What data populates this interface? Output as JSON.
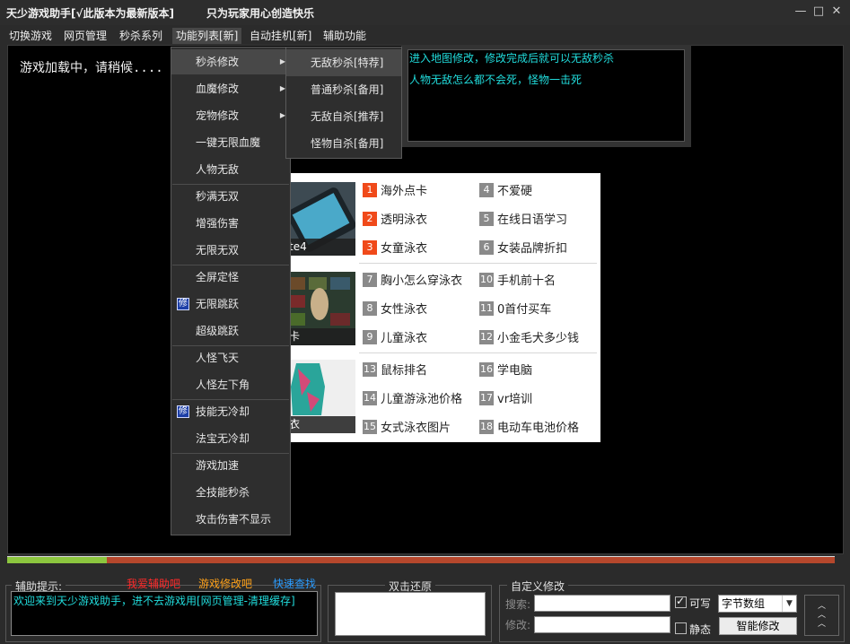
{
  "titlebar": {
    "title": "天少游戏助手[√此版本为最新版本]",
    "slogan": "只为玩家用心创造快乐",
    "buttons": [
      "—",
      "□",
      "✕"
    ]
  },
  "menubar": [
    "切换游戏",
    "网页管理",
    "秒杀系列",
    "功能列表[新]",
    "自动挂机[新]",
    "辅助功能"
  ],
  "main": {
    "loading_text": "游戏加载中，请稍候...."
  },
  "info": {
    "lines": [
      "进入地图修改，修改完成后就可以无敌秒杀",
      "人物无敌怎么都不会死，怪物一击死"
    ]
  },
  "dropdown": {
    "items": [
      "秒杀修改",
      "血魔修改",
      "宠物修改",
      "一键无限血魔",
      "人物无敌",
      "秒满无双",
      "增强伤害",
      "无限无双",
      "全屏定怪",
      "无限跳跃",
      "超级跳跃",
      "人怪飞天",
      "人怪左下角",
      "技能无冷却",
      "法宝无冷却",
      "游戏加速",
      "全技能秒杀",
      "攻击伤害不显示"
    ],
    "check_glyph": "修"
  },
  "submenu": {
    "items": [
      "无敌秒杀[特荐]",
      "普通秒杀[备用]",
      "无敌自杀[推荐]",
      "怪物自杀[备用]"
    ]
  },
  "ads": {
    "captions": [
      "te4",
      "卡",
      "衣"
    ],
    "links": [
      {
        "num": "1",
        "text": "海外点卡"
      },
      {
        "num": "4",
        "text": "不爱硬"
      },
      {
        "num": "2",
        "text": "透明泳衣"
      },
      {
        "num": "5",
        "text": "在线日语学习"
      },
      {
        "num": "3",
        "text": "女童泳衣"
      },
      {
        "num": "6",
        "text": "女装品牌折扣"
      },
      {
        "num": "7",
        "text": "胸小怎么穿泳衣"
      },
      {
        "num": "10",
        "text": "手机前十名"
      },
      {
        "num": "8",
        "text": "女性泳衣"
      },
      {
        "num": "11",
        "text": "0首付买车"
      },
      {
        "num": "9",
        "text": "儿童泳衣"
      },
      {
        "num": "12",
        "text": "小金毛犬多少钱"
      },
      {
        "num": "13",
        "text": "鼠标排名"
      },
      {
        "num": "16",
        "text": "学电脑"
      },
      {
        "num": "14",
        "text": "儿童游泳池价格"
      },
      {
        "num": "17",
        "text": "vr培训"
      },
      {
        "num": "15",
        "text": "女式泳衣图片"
      },
      {
        "num": "18",
        "text": "电动车电池价格"
      }
    ],
    "hot_color": "#f04a1a",
    "cold_color": "#8a8a8a"
  },
  "progress": {
    "value": 0.12,
    "fill_color": "#8cc63f",
    "track_color": "#b5472c"
  },
  "bottom": {
    "hint_title": "辅助提示:",
    "link_1": "我爱辅助吧",
    "link_2": "游戏修改吧",
    "link_3": "快速查找",
    "hint_text": "欢迎来到天少游戏助手，进不去游戏用[网页管理-清理缓存]",
    "restore_title": "双击还原",
    "custom_title": "自定义修改",
    "search_label": "搜索:",
    "modify_label": "修改:",
    "writable_label": "可写",
    "writable_checked": true,
    "static_label": "静态",
    "static_checked": false,
    "type_value": "字节数组",
    "smart_button": "智能修改"
  }
}
